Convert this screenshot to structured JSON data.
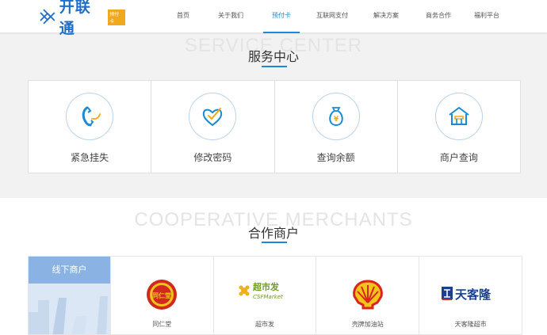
{
  "header": {
    "logo_text": "开联通",
    "logo_badge": "预付卡",
    "nav": [
      {
        "label": "首页",
        "active": false
      },
      {
        "label": "关于我们",
        "active": false
      },
      {
        "label": "预付卡",
        "active": true
      },
      {
        "label": "互联网支付",
        "active": false
      },
      {
        "label": "解决方案",
        "active": false
      },
      {
        "label": "商务合作",
        "active": false
      },
      {
        "label": "福利平台",
        "active": false
      }
    ]
  },
  "service": {
    "bg_text": "SERVICE CENTER",
    "title": "服务中心",
    "items": [
      {
        "label": "紧急挂失",
        "icon": "phone-icon"
      },
      {
        "label": "修改密码",
        "icon": "heart-check-icon"
      },
      {
        "label": "查询余额",
        "icon": "money-bag-icon"
      },
      {
        "label": "商户查询",
        "icon": "shop-icon"
      }
    ]
  },
  "coop": {
    "bg_text": "COOPERATIVE MERCHANTS",
    "title": "合作商户",
    "offline_label": "线下商户",
    "merchants": [
      {
        "name": "同仁堂",
        "icon": "tongrentang-logo"
      },
      {
        "name": "超市发",
        "icon": "csf-market-logo"
      },
      {
        "name": "壳牌加油站",
        "icon": "shell-logo"
      },
      {
        "name": "天客隆超市",
        "icon": "tiankelong-logo"
      }
    ],
    "logo_texts": {
      "tongrentang": "同仁堂",
      "csf_cn": "超市发",
      "csf_en": "CSFMarket",
      "tiankelong": "天客隆"
    }
  },
  "colors": {
    "accent": "#1a8ad4",
    "logo_blue": "#1f6fc9",
    "offline_tab": "#8ab3e3"
  }
}
